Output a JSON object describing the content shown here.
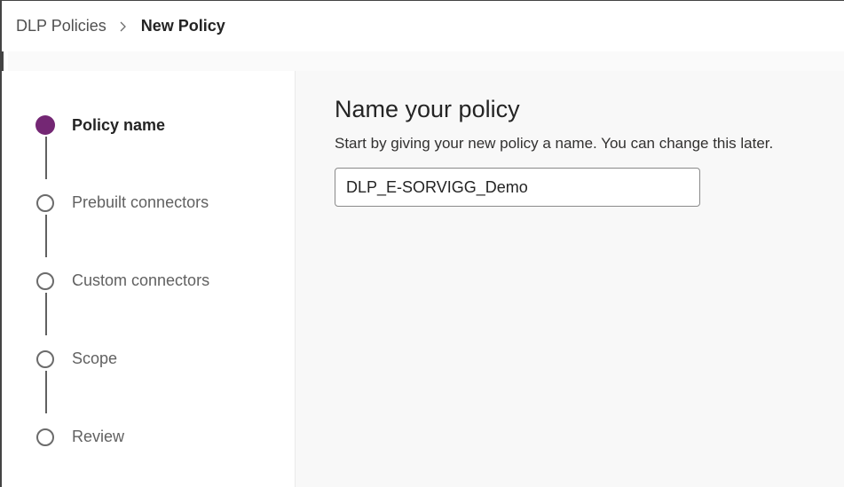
{
  "breadcrumb": {
    "parent": "DLP Policies",
    "current": "New Policy"
  },
  "icons": {
    "separator": "chevron-right-icon"
  },
  "colors": {
    "accent": "#742774",
    "panel_background": "#f8f8f8"
  },
  "steps": [
    {
      "label": "Policy name",
      "state": "active"
    },
    {
      "label": "Prebuilt connectors",
      "state": "pending"
    },
    {
      "label": "Custom connectors",
      "state": "pending"
    },
    {
      "label": "Scope",
      "state": "pending"
    },
    {
      "label": "Review",
      "state": "pending"
    }
  ],
  "main": {
    "title": "Name your policy",
    "description": "Start by giving your new policy a name. You can change this later.",
    "policy_name_value": "DLP_E-SORVIGG_Demo"
  }
}
